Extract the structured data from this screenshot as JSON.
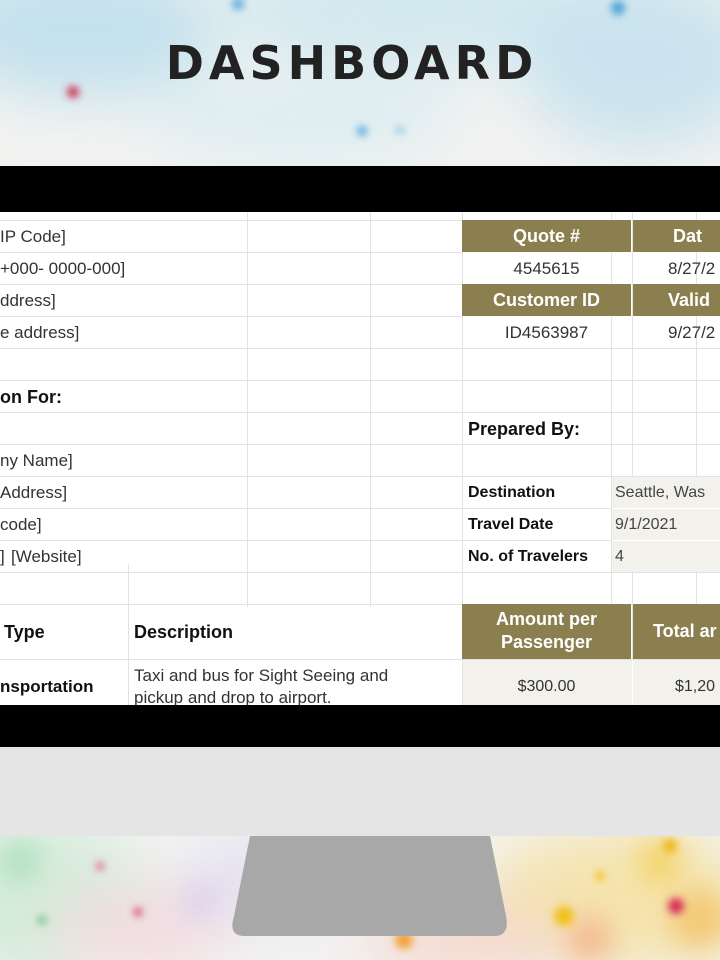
{
  "page": {
    "title": "DASHBOARD"
  },
  "company_info": {
    "line_zip": "IP Code]",
    "line_phone": "+000- 0000-000]",
    "line_address": "ddress]",
    "line_email": "e address]"
  },
  "quote_header": {
    "quote_label": "Quote #",
    "date_label": "Dat",
    "quote_value": "4545615",
    "date_value": "8/27/2",
    "customer_label": "Customer ID",
    "valid_label": "Valid",
    "customer_value": "ID4563987",
    "valid_value": "9/27/2"
  },
  "quotation_for": {
    "heading": "on For:",
    "company_name": "ny Name]",
    "address": "Address]",
    "zip": "code]",
    "website_prefix": "]",
    "website": "[Website]"
  },
  "prepared_by": {
    "label": "Prepared By:",
    "destination_label": "Destination",
    "destination_value": "Seattle, Was",
    "travel_date_label": "Travel Date",
    "travel_date_value": "9/1/2021",
    "travelers_label": "No. of Travelers",
    "travelers_value": "4"
  },
  "cost_table": {
    "type_header": "Type",
    "description_header": "Description",
    "amount_header_line1": "Amount per",
    "amount_header_line2": "Passenger",
    "total_header": "Total ar",
    "rows": [
      {
        "type": "nsportation",
        "description_line1": "Taxi and bus for Sight Seeing and",
        "description_line2": "pickup and drop to airport.",
        "amount": "$300.00",
        "total": "$1,20"
      }
    ]
  }
}
